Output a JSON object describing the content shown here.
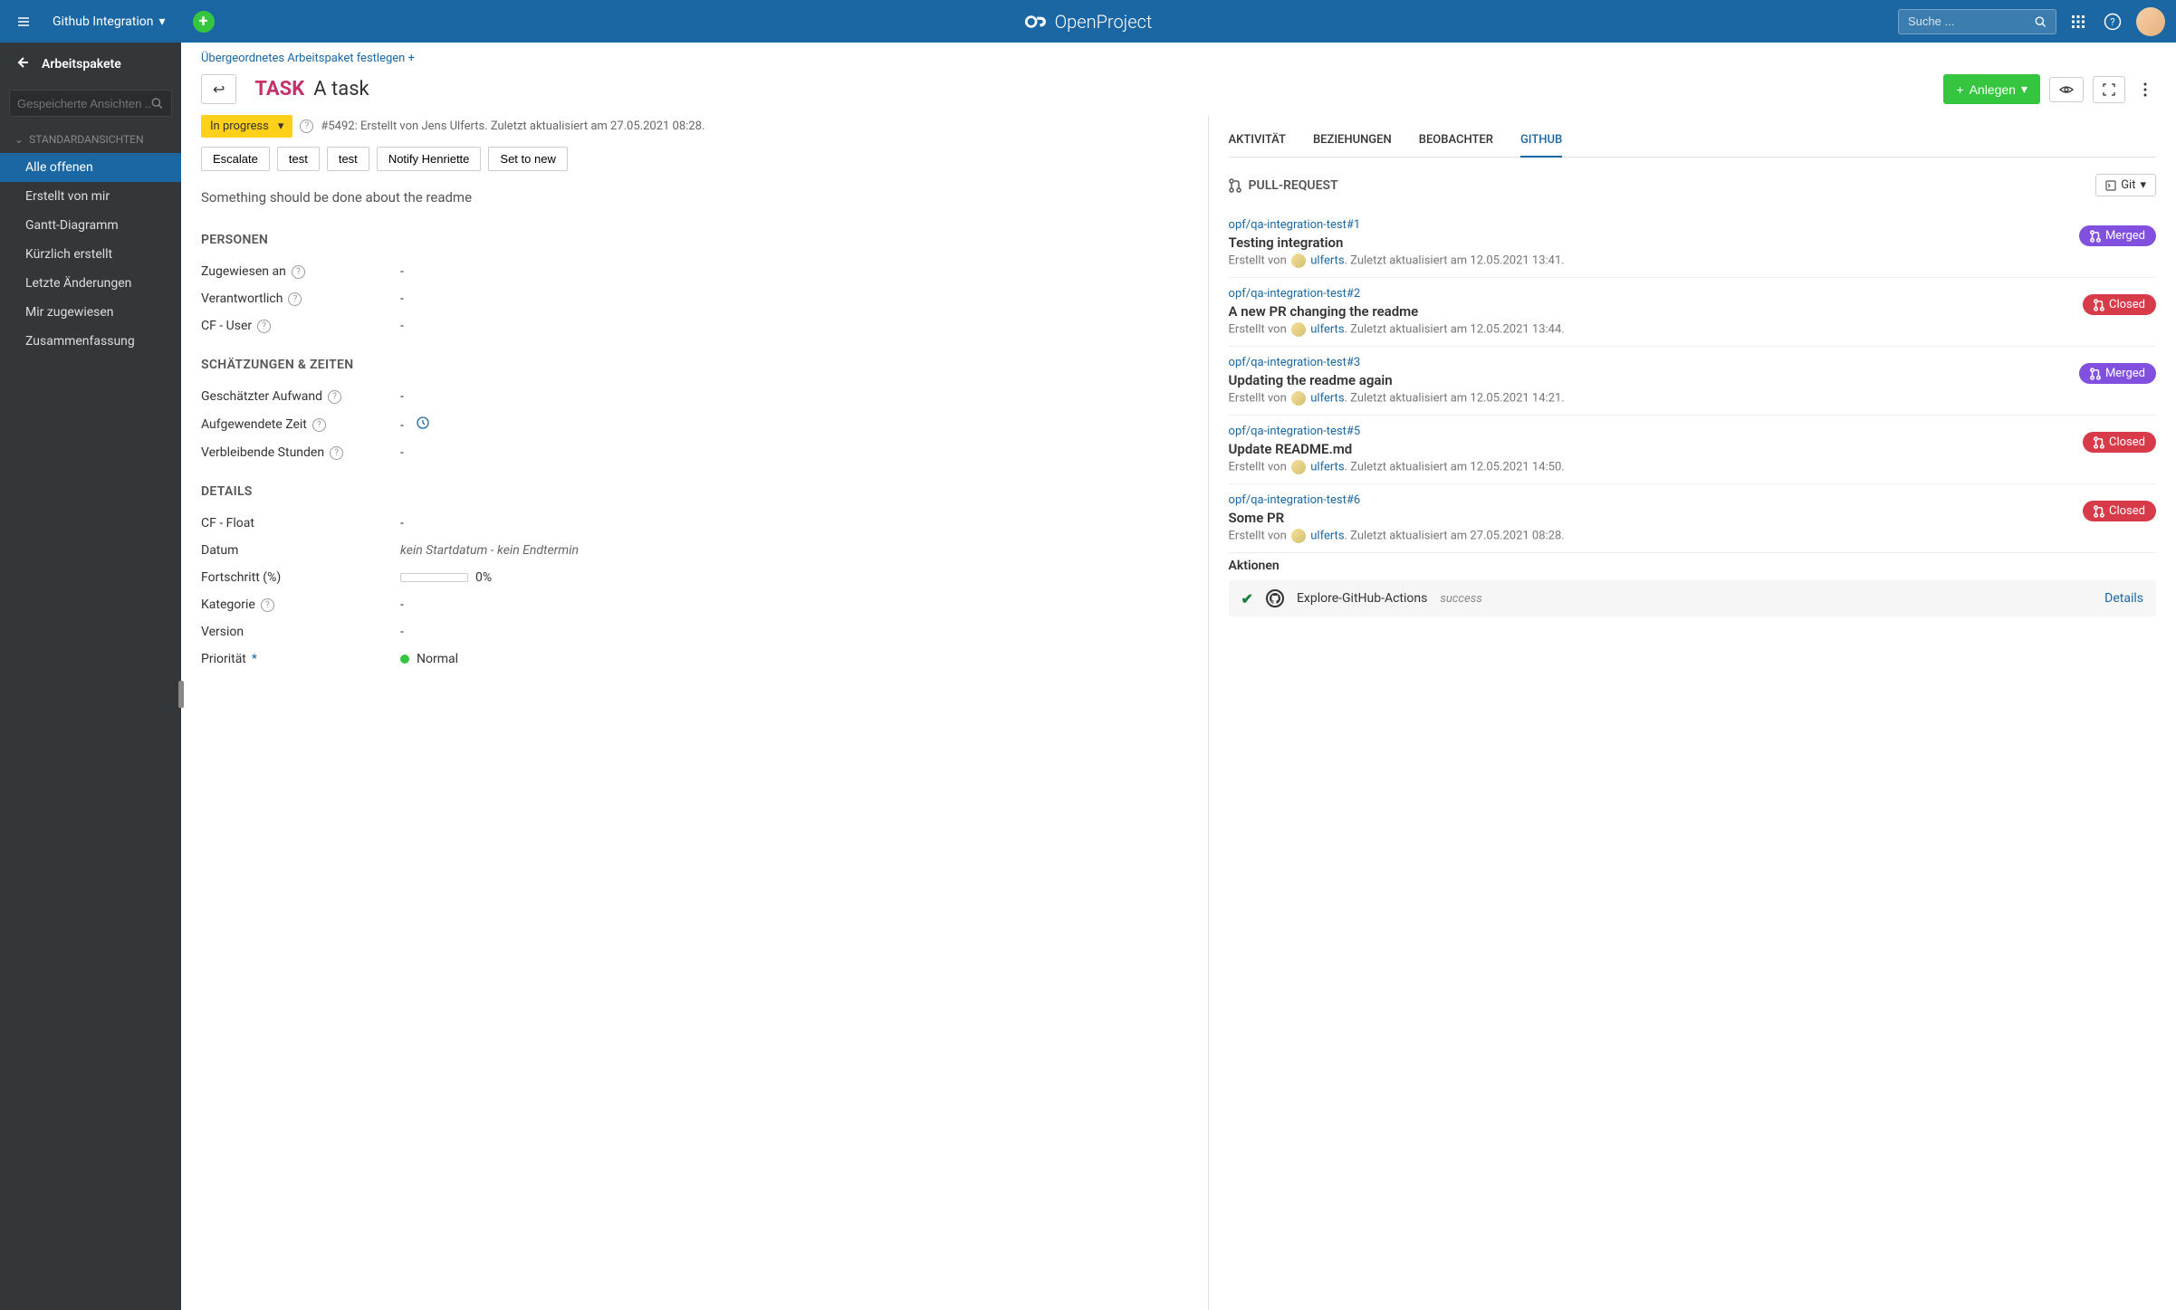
{
  "header": {
    "project_name": "Github Integration",
    "brand": "OpenProject",
    "search_placeholder": "Suche ..."
  },
  "sidebar": {
    "title": "Arbeitspakete",
    "search_placeholder": "Gespeicherte Ansichten ...",
    "section_label": "STANDARDANSICHTEN",
    "items": [
      {
        "label": "Alle offenen",
        "active": true
      },
      {
        "label": "Erstellt von mir"
      },
      {
        "label": "Gantt-Diagramm"
      },
      {
        "label": "Kürzlich erstellt"
      },
      {
        "label": "Letzte Änderungen"
      },
      {
        "label": "Mir zugewiesen"
      },
      {
        "label": "Zusammenfassung"
      }
    ]
  },
  "breadcrumb": {
    "set_parent": "Übergeordnetes Arbeitspaket festlegen"
  },
  "wp": {
    "type": "TASK",
    "subject": "A task",
    "create_button": "Anlegen",
    "status": "In progress",
    "meta": "#5492: Erstellt von Jens Ulferts. Zuletzt aktualisiert am 27.05.2021 08:28.",
    "actions": [
      "Escalate",
      "test",
      "test",
      "Notify Henriette",
      "Set to new"
    ],
    "description": "Something should be done about the readme"
  },
  "sections": {
    "people": {
      "title": "PERSONEN",
      "fields": [
        {
          "label": "Zugewiesen an",
          "value": "-",
          "help": true
        },
        {
          "label": "Verantwortlich",
          "value": "-",
          "help": true
        },
        {
          "label": "CF - User",
          "value": "-",
          "help": true
        }
      ]
    },
    "estimates": {
      "title": "SCHÄTZUNGEN & ZEITEN",
      "fields": [
        {
          "label": "Geschätzter Aufwand",
          "value": "-",
          "help": true
        },
        {
          "label": "Aufgewendete Zeit",
          "value": "-",
          "help": true,
          "clock": true
        },
        {
          "label": "Verbleibende Stunden",
          "value": "-",
          "help": true
        }
      ]
    },
    "details": {
      "title": "DETAILS",
      "fields": [
        {
          "label": "CF - Float",
          "value": "-"
        },
        {
          "label": "Datum",
          "value_italic": "kein Startdatum - kein Endtermin"
        },
        {
          "label": "Fortschritt (%)",
          "progress": "0%"
        },
        {
          "label": "Kategorie",
          "value": "-",
          "help": true
        },
        {
          "label": "Version",
          "value": "-"
        },
        {
          "label": "Priorität",
          "required": true,
          "priority": "Normal"
        }
      ]
    }
  },
  "tabs": {
    "items": [
      "AKTIVITÄT",
      "BEZIEHUNGEN",
      "BEOBACHTER",
      "GITHUB"
    ],
    "active": "GITHUB"
  },
  "github": {
    "section_title": "PULL-REQUEST",
    "git_button": "Git",
    "prs": [
      {
        "repo": "opf/qa-integration-test#1",
        "title": "Testing integration",
        "created_by_prefix": "Erstellt von",
        "user": "ulferts",
        "updated": ". Zuletzt aktualisiert am 12.05.2021 13:41.",
        "state": "Merged",
        "state_class": "merged"
      },
      {
        "repo": "opf/qa-integration-test#2",
        "title": "A new PR changing the readme",
        "created_by_prefix": "Erstellt von",
        "user": "ulferts",
        "updated": ". Zuletzt aktualisiert am 12.05.2021 13:44.",
        "state": "Closed",
        "state_class": "closed"
      },
      {
        "repo": "opf/qa-integration-test#3",
        "title": "Updating the readme again",
        "created_by_prefix": "Erstellt von",
        "user": "ulferts",
        "updated": ". Zuletzt aktualisiert am 12.05.2021 14:21.",
        "state": "Merged",
        "state_class": "merged"
      },
      {
        "repo": "opf/qa-integration-test#5",
        "title": "Update README.md",
        "created_by_prefix": "Erstellt von",
        "user": "ulferts",
        "updated": ". Zuletzt aktualisiert am 12.05.2021 14:50.",
        "state": "Closed",
        "state_class": "closed"
      },
      {
        "repo": "opf/qa-integration-test#6",
        "title": "Some PR",
        "created_by_prefix": "Erstellt von",
        "user": "ulferts",
        "updated": ". Zuletzt aktualisiert am 27.05.2021 08:28.",
        "state": "Closed",
        "state_class": "closed",
        "has_actions": true
      }
    ],
    "actions_label": "Aktionen",
    "action_run": {
      "name": "Explore-GitHub-Actions",
      "status": "success",
      "details": "Details"
    }
  }
}
